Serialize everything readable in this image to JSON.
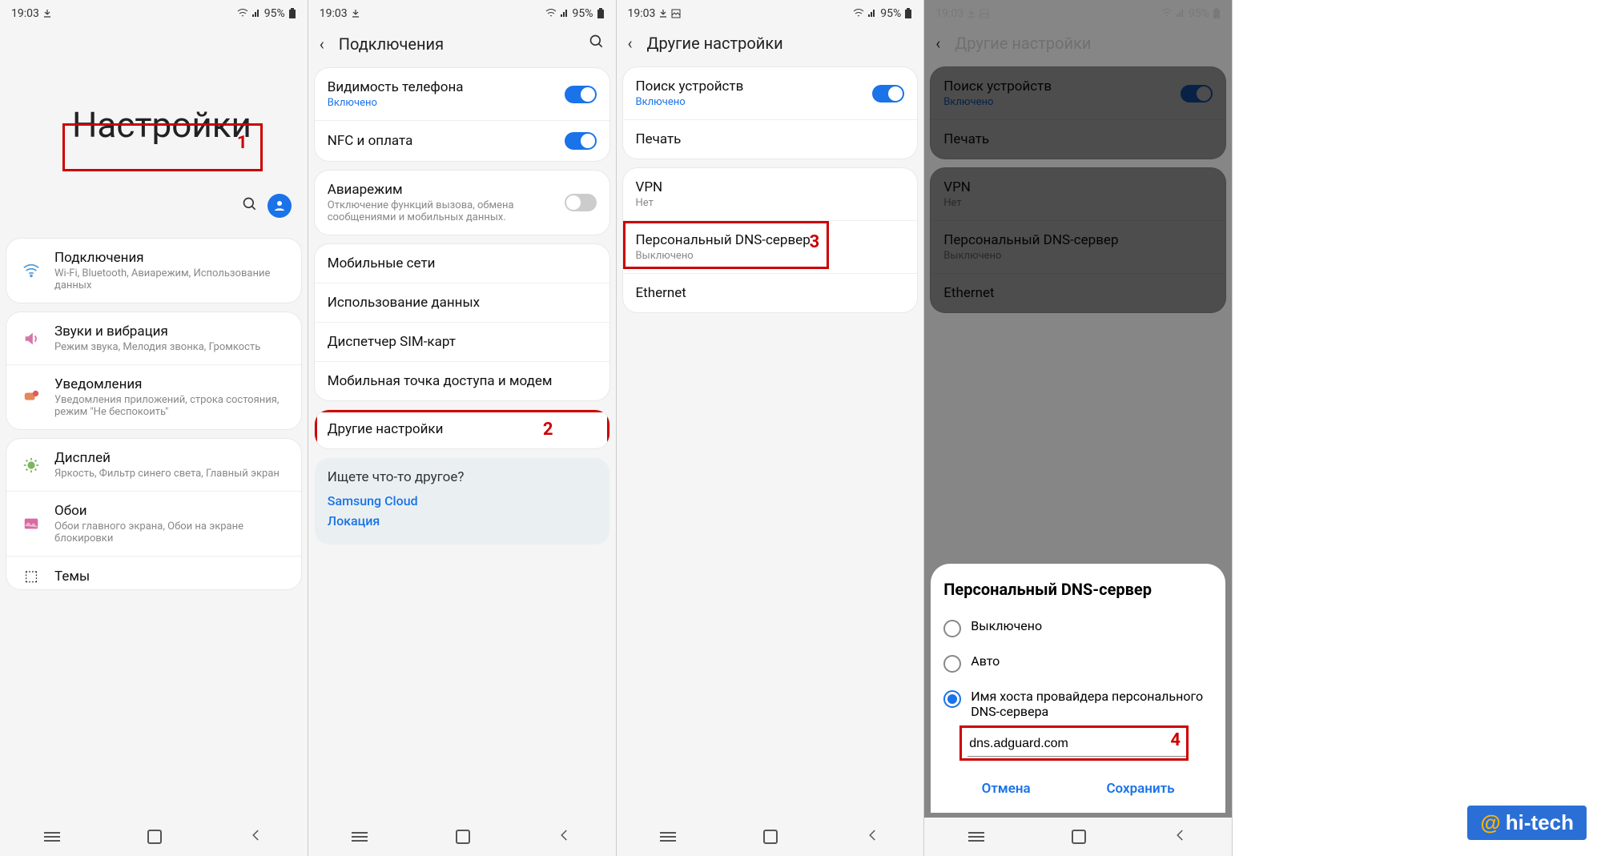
{
  "status": {
    "time": "19:03",
    "battery_pct": "95%"
  },
  "s1": {
    "title": "Настройки",
    "marker": "1",
    "items": [
      {
        "icon": "wifi",
        "title": "Подключения",
        "sub": "Wi-Fi, Bluetooth, Авиарежим, Использование данных"
      },
      {
        "icon": "sound",
        "title": "Звуки и вибрация",
        "sub": "Режим звука, Мелодия звонка, Громкость"
      },
      {
        "icon": "notif",
        "title": "Уведомления",
        "sub": "Уведомления приложений, строка состояния, режим \"Не беспокоить\""
      },
      {
        "icon": "display",
        "title": "Дисплей",
        "sub": "Яркость, Фильтр синего света, Главный экран"
      },
      {
        "icon": "wall",
        "title": "Обои",
        "sub": "Обои главного экрана, Обои на экране блокировки"
      },
      {
        "icon": "theme",
        "title": "Темы",
        "sub": ""
      }
    ]
  },
  "s2": {
    "title": "Подключения",
    "marker": "2",
    "g1": [
      {
        "title": "Видимость телефона",
        "sub": "Включено",
        "toggle": "on"
      },
      {
        "title": "NFC и оплата",
        "sub": "",
        "toggle": "on"
      }
    ],
    "g2": [
      {
        "title": "Авиарежим",
        "sub": "Отключение функций вызова, обмена сообщениями и мобильных данных.",
        "toggle": "off"
      }
    ],
    "g3": [
      {
        "title": "Мобильные сети"
      },
      {
        "title": "Использование данных"
      },
      {
        "title": "Диспетчер SIM-карт"
      },
      {
        "title": "Мобильная точка доступа и модем"
      }
    ],
    "other": "Другие настройки",
    "info_q": "Ищете что-то другое?",
    "info_links": [
      "Samsung Cloud",
      "Локация"
    ]
  },
  "s3": {
    "title": "Другие настройки",
    "marker": "3",
    "g1": [
      {
        "title": "Поиск устройств",
        "sub": "Включено",
        "toggle": "on"
      },
      {
        "title": "Печать"
      }
    ],
    "g2": [
      {
        "title": "VPN",
        "sub": "Нет"
      },
      {
        "title": "Персональный DNS-сервер",
        "sub": "Выключено",
        "hl": true
      },
      {
        "title": "Ethernet",
        "disabled": true
      }
    ]
  },
  "s4": {
    "title": "Другие настройки",
    "marker": "4",
    "sheet_title": "Персональный DNS-сервер",
    "opt_off": "Выключено",
    "opt_auto": "Авто",
    "opt_host": "Имя хоста провайдера персонального DNS-сервера",
    "input": "dns.adguard.com",
    "cancel": "Отмена",
    "save": "Сохранить"
  },
  "watermark": {
    "at": "@",
    "txt": "hi-tech"
  }
}
